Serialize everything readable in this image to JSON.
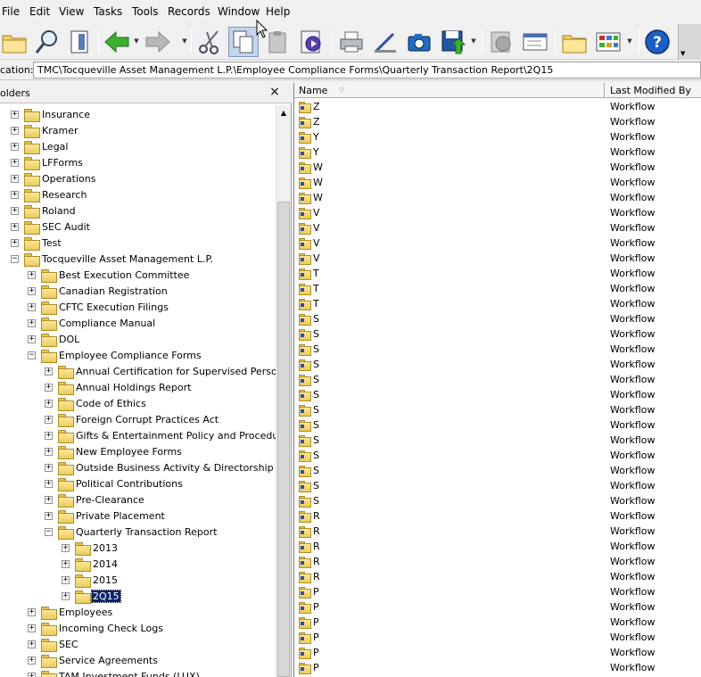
{
  "menu": [
    "File",
    "Edit",
    "View",
    "Tasks",
    "Tools",
    "Records",
    "Window",
    "Help"
  ],
  "toolbar": {
    "buttons": [
      {
        "name": "open-folder-icon"
      },
      {
        "name": "search-icon"
      },
      {
        "name": "document-view-icon"
      },
      {
        "name": "back-arrow-icon"
      },
      {
        "name": "forward-arrow-icon"
      },
      {
        "name": "cut-icon"
      },
      {
        "name": "copy-icon"
      },
      {
        "name": "paste-icon"
      },
      {
        "name": "workflow-gear-icon"
      },
      {
        "name": "print-icon"
      },
      {
        "name": "scanner-icon"
      },
      {
        "name": "camera-icon"
      },
      {
        "name": "save-export-icon"
      },
      {
        "name": "global-web-icon"
      },
      {
        "name": "properties-icon"
      },
      {
        "name": "new-folder-icon"
      },
      {
        "name": "view-mode-icon"
      },
      {
        "name": "help-icon"
      }
    ]
  },
  "location": {
    "label": "cation:",
    "path": "TMC\\Tocqueville Asset Management L.P.\\Employee Compliance Forms\\Quarterly Transaction Report\\2Q15"
  },
  "folders_pane": {
    "title": "olders",
    "close": "×",
    "items": [
      {
        "label": "Insurance",
        "level": 0,
        "expander": "+"
      },
      {
        "label": "Kramer",
        "level": 0,
        "expander": "+"
      },
      {
        "label": "Legal",
        "level": 0,
        "expander": "+"
      },
      {
        "label": "LFForms",
        "level": 0,
        "expander": "+"
      },
      {
        "label": "Operations",
        "level": 0,
        "expander": "+"
      },
      {
        "label": "Research",
        "level": 0,
        "expander": "+"
      },
      {
        "label": "Roland",
        "level": 0,
        "expander": "+"
      },
      {
        "label": "SEC Audit",
        "level": 0,
        "expander": "+"
      },
      {
        "label": "Test",
        "level": 0,
        "expander": "+"
      },
      {
        "label": "Tocqueville Asset Management L.P.",
        "level": 0,
        "expander": "−"
      },
      {
        "label": "Best Execution Committee",
        "level": 1,
        "expander": "+"
      },
      {
        "label": "Canadian Registration",
        "level": 1,
        "expander": "+"
      },
      {
        "label": "CFTC Execution Filings",
        "level": 1,
        "expander": "+"
      },
      {
        "label": "Compliance Manual",
        "level": 1,
        "expander": "+"
      },
      {
        "label": "DOL",
        "level": 1,
        "expander": "+"
      },
      {
        "label": "Employee Compliance Forms",
        "level": 1,
        "expander": "−"
      },
      {
        "label": "Annual Certification for Supervised Persons",
        "level": 2,
        "expander": "+"
      },
      {
        "label": "Annual Holdings Report",
        "level": 2,
        "expander": "+"
      },
      {
        "label": "Code of Ethics",
        "level": 2,
        "expander": "+"
      },
      {
        "label": "Foreign Corrupt Practices Act",
        "level": 2,
        "expander": "+"
      },
      {
        "label": "Gifts & Entertainment Policy and Procedure Ce",
        "level": 2,
        "expander": "+"
      },
      {
        "label": "New Employee Forms",
        "level": 2,
        "expander": "+"
      },
      {
        "label": "Outside Business Activity & Directorship",
        "level": 2,
        "expander": "+"
      },
      {
        "label": "Political Contributions",
        "level": 2,
        "expander": "+"
      },
      {
        "label": "Pre-Clearance",
        "level": 2,
        "expander": "+"
      },
      {
        "label": "Private Placement",
        "level": 2,
        "expander": "+"
      },
      {
        "label": "Quarterly Transaction Report",
        "level": 2,
        "expander": "−"
      },
      {
        "label": "2013",
        "level": 3,
        "expander": "+"
      },
      {
        "label": "2014",
        "level": 3,
        "expander": "+"
      },
      {
        "label": "2015",
        "level": 3,
        "expander": "+"
      },
      {
        "label": "2Q15",
        "level": 3,
        "expander": "+",
        "selected": true
      },
      {
        "label": "Employees",
        "level": 1,
        "expander": "+"
      },
      {
        "label": "Incoming Check Logs",
        "level": 1,
        "expander": "+"
      },
      {
        "label": "SEC",
        "level": 1,
        "expander": "+"
      },
      {
        "label": "Service Agreements",
        "level": 1,
        "expander": "+"
      },
      {
        "label": "TAM Investment Funds (LUX)",
        "level": 1,
        "expander": "+"
      }
    ]
  },
  "list_pane": {
    "columns": {
      "name": "Name",
      "modified_by": "Last Modified By"
    },
    "rows": [
      {
        "name": "Z",
        "modified_by": "Workflow"
      },
      {
        "name": "Z",
        "modified_by": "Workflow"
      },
      {
        "name": "Y",
        "modified_by": "Workflow"
      },
      {
        "name": "Y",
        "modified_by": "Workflow"
      },
      {
        "name": "W",
        "modified_by": "Workflow"
      },
      {
        "name": "W",
        "modified_by": "Workflow"
      },
      {
        "name": "W",
        "modified_by": "Workflow"
      },
      {
        "name": "V",
        "modified_by": "Workflow"
      },
      {
        "name": "V",
        "modified_by": "Workflow"
      },
      {
        "name": "V",
        "modified_by": "Workflow"
      },
      {
        "name": "V",
        "modified_by": "Workflow"
      },
      {
        "name": "T",
        "modified_by": "Workflow"
      },
      {
        "name": "T",
        "modified_by": "Workflow"
      },
      {
        "name": "T",
        "modified_by": "Workflow"
      },
      {
        "name": "S",
        "modified_by": "Workflow"
      },
      {
        "name": "S",
        "modified_by": "Workflow"
      },
      {
        "name": "S",
        "modified_by": "Workflow"
      },
      {
        "name": "S",
        "modified_by": "Workflow"
      },
      {
        "name": "S",
        "modified_by": "Workflow"
      },
      {
        "name": "S",
        "modified_by": "Workflow"
      },
      {
        "name": "S",
        "modified_by": "Workflow"
      },
      {
        "name": "S",
        "modified_by": "Workflow"
      },
      {
        "name": "S",
        "modified_by": "Workflow"
      },
      {
        "name": "S",
        "modified_by": "Workflow"
      },
      {
        "name": "S",
        "modified_by": "Workflow"
      },
      {
        "name": "S",
        "modified_by": "Workflow"
      },
      {
        "name": "S",
        "modified_by": "Workflow"
      },
      {
        "name": "R",
        "modified_by": "Workflow"
      },
      {
        "name": "R",
        "modified_by": "Workflow"
      },
      {
        "name": "R",
        "modified_by": "Workflow"
      },
      {
        "name": "R",
        "modified_by": "Workflow"
      },
      {
        "name": "R",
        "modified_by": "Workflow"
      },
      {
        "name": "P",
        "modified_by": "Workflow"
      },
      {
        "name": "P",
        "modified_by": "Workflow"
      },
      {
        "name": "P",
        "modified_by": "Workflow"
      },
      {
        "name": "P",
        "modified_by": "Workflow"
      },
      {
        "name": "P",
        "modified_by": "Workflow"
      },
      {
        "name": "P",
        "modified_by": "Workflow"
      }
    ]
  },
  "colors": {
    "selection": "#0a246a",
    "folder": "#eccb5c",
    "toolbar_pressed": "#c5d5ea"
  }
}
